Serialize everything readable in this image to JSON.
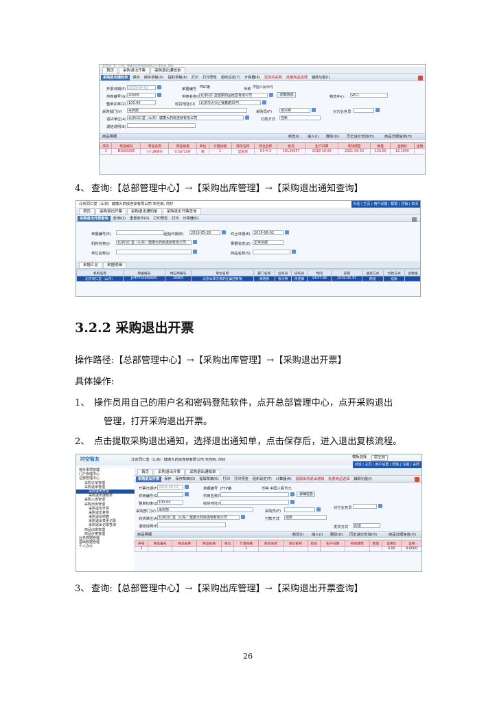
{
  "top_shot": {
    "header_partial": "北京同仁堂（山东）健康大药房连锁有限公司 宋佳雨, 你好",
    "tabs": [
      "首页",
      "采购退出开票",
      "采购退出通知单"
    ],
    "toolbar": {
      "title": "采购退出通知单",
      "items": [
        "保存",
        "保存草稿(O)",
        "提取草稿(K)",
        "打印",
        "打印预览",
        "组织设定(T)",
        "计算器(K)",
        "需求的采购",
        "批量商品选择",
        "辅助功能(I)"
      ]
    },
    "form": {
      "open_date_label": "开票日期(F)",
      "open_date": "2019-06-02",
      "doc_no_label": "单据编号",
      "doc_no": "PNC番",
      "currency_label": "币种",
      "currency": "中国人民币元",
      "supplier_code_label": "供商编号(G)",
      "supplier_code": "20005",
      "supplier_name_label": "供商名称(Y)",
      "supplier_name": "北京同仁堂健康药品经营有限公司",
      "detail_btn": "详细信息",
      "logistics_label": "物流中心:",
      "logistics": "W11",
      "amount_label": "整单扣率(Z)",
      "amount": "100.00",
      "address_label": "收货地址(U)",
      "address": "北京市大兴区赛鑫路39号",
      "dept_label": "采购部门(V)",
      "dept": "采购部",
      "buyer_label": "采购员(F)",
      "buyer": "张兴特",
      "party_label": "对方业务员",
      "ship_label": "退货单位(A)",
      "ship": "北京同仁堂（山东）健康大药房连锁有限公司",
      "pay_label": "付款方式",
      "pay": "挂账",
      "note_label": "退结说明(E)"
    },
    "detail_bar": {
      "title": "商品明细",
      "actions": [
        "新增(I)",
        "插入(I)",
        "删除(D)",
        "历史进价查询(H)",
        "商品详细信息(H)"
      ]
    },
    "columns": [
      "序号",
      "商品编号",
      "商品名称",
      "商品规格",
      "单位",
      "计量规格",
      "库房名称",
      "货位名称",
      "批号",
      "生产日期",
      "有效期至",
      "数量",
      "含税价",
      "含税"
    ],
    "rows": [
      [
        "1",
        "B1000396",
        "小儿麻感片",
        "0.3g*10片",
        "瓶",
        "1",
        "宫宝库",
        "C3-4-3",
        "18120957",
        "2018-10-29",
        "2021-09-30",
        "120.00",
        "12.1040",
        ""
      ]
    ]
  },
  "step4": {
    "num": "4、",
    "text": "查询:【总部管理中心】→【采购出库管理】→【采购退出通知查询】"
  },
  "mid_shot": {
    "header": "北京同仁堂（山东）健康大药房连锁有限公司 宋佳雨, 你好",
    "nav": [
      "对话",
      "主页",
      "用户设置",
      "帮助",
      "注销",
      "关闭"
    ],
    "tabs": [
      "首页",
      "采购退出开票",
      "采购退出通知单",
      "采购退出开票查询"
    ],
    "toolbar": {
      "title": "采购退出开票查询",
      "items": [
        "查询(Q)",
        "重置条件(R)",
        "打印预览",
        "打印",
        "计算器(K)"
      ]
    },
    "form": {
      "doc_label": "单据编号(E)",
      "start_label": "起始日期(E)",
      "start": "2019-05-28",
      "end_label": "终止日期(E)",
      "end": "2019-06-02",
      "org_label": "机构名称(J)",
      "org": "北京同仁堂（山东）健康大药房连锁有限公司",
      "state_label": "票据状态(Z)",
      "state": "正常票据",
      "unit_label": "单位名称(J)",
      "goods_label": "商品名称(S)"
    },
    "subtabs": [
      "单据汇总",
      "单据明细"
    ],
    "columns": [
      "机构名称",
      "单据编号",
      "供应商编号",
      "单位名称",
      "部门名称",
      "业务员",
      "操作员",
      "时间",
      "日期",
      "送货方式",
      "付款方式",
      "含税金"
    ],
    "rows": [
      [
        "北京同仁堂（山东）",
        "JHTPT00000005",
        "20005",
        "北京本草方源药业集团有限",
        "采购部",
        "张兴特",
        "宋佳雨",
        "14:57:46",
        "2019-05-31",
        "配送",
        "挂账",
        ""
      ]
    ]
  },
  "section": {
    "heading": "3.2.2 采购退出开票"
  },
  "paragraphs": {
    "path": "操作路径:【总部管理中心】→【采购出库管理】→【采购退出开票】",
    "specific": "具体操作:",
    "step1_num": "1、",
    "step1_line1": "操作员用自己的用户名和密码登陆软件，点开总部管理中心，点开采购退出",
    "step1_line2": "管理，打开采购退出开票。",
    "step2_num": "2、",
    "step2_text": "点击提取采购退出通知，选择退出通知单，点击保存后，进入退出复核流程。"
  },
  "bottom_shot": {
    "logo": "时空智友",
    "header": "北京同仁堂（山东）健康大药房连锁有限公司 宋佳雨, 你好",
    "skin_label": "模板选择",
    "skin": "原文档",
    "nav": [
      "对话",
      "主页",
      "用户设置",
      "帮助",
      "注销",
      "关闭"
    ],
    "tabs": [
      "首页",
      "采购退出开票",
      "采购退出通知单"
    ],
    "toolbar": {
      "title": "采购退出开票",
      "items": [
        "保存",
        "保存草稿(O)",
        "提取草稿(K)",
        "打印",
        "打印预览",
        "组织设定(T)",
        "计算器(K)",
        "提取采购退出通知",
        "批量商品选择",
        "辅助功能(I)"
      ]
    },
    "sidebar": [
      "待办事项管理",
      "门户管理中心",
      "总部管理中心",
      "采购订单管理",
      "采购退单管理",
      "采购退出开票",
      "采购退出通知单",
      "采购入库管理",
      "采购出库管理",
      "采购退出开票",
      "采购退出复核",
      "采购退出结算",
      "采购退出变更记录",
      "采购退出记录查询",
      "商品出库管理",
      "商品价格管理",
      "业务数据管理",
      "基础数据管理",
      "个人办公"
    ],
    "form": {
      "open_date_label": "开票日期(F)",
      "open_date": "2019-06-02",
      "doc_no_label": "单据编号",
      "doc_no": "JFTP番",
      "currency_label": "币种",
      "currency": "中国人民币元",
      "supplier_code_label": "供商编号(G)",
      "supplier_name_label": "供商名称(Y)",
      "detail_btn": "详细信息",
      "amount_label": "整单扣率(Z)",
      "amount": "100.00",
      "address_label": "收货地址(U)",
      "party_label": "对方业务员",
      "dept_label": "采购部门(V)",
      "dept": "采购部",
      "buyer_label": "采购员(F)",
      "recv_label": "收货单位(A)",
      "recv": "北京同仁堂（山东）健康大药房连锁有限公司",
      "pay_label": "付款方式",
      "pay": "挂账",
      "note_label": "退结说明(E)",
      "ship_label": "发货方式",
      "ship": "配送"
    },
    "detail_bar": {
      "title": "商品明细",
      "actions": [
        "新增(I)",
        "插入(I)",
        "删除(D)",
        "历史进价查询(H)",
        "商品详细信息(H)"
      ]
    },
    "columns": [
      "序号",
      "商品编号",
      "商品名称",
      "商品规格",
      "单位",
      "计量规格",
      "库房名称",
      "货位名称",
      "批号",
      "生产日期",
      "有效期至",
      "数量",
      "含税价",
      "含税"
    ],
    "rows": [
      [
        "1",
        "",
        "",
        "",
        "",
        "1",
        "",
        "",
        "",
        "",
        "",
        "",
        "0.00",
        "0.0000"
      ]
    ]
  },
  "step3": {
    "num": "3、",
    "text": "查询:【总部管理中心】→【采购出库管理】→【采购退出开票查询】"
  },
  "page_number": "26"
}
